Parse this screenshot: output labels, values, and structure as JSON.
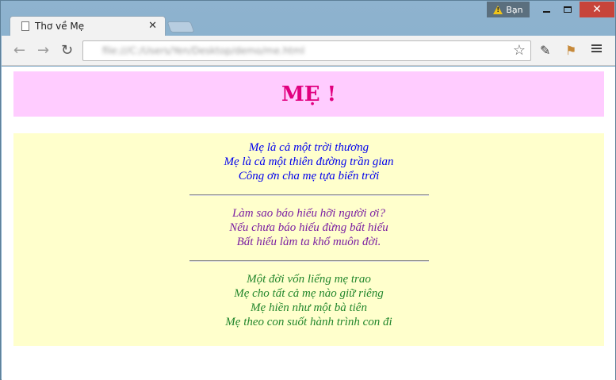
{
  "browser": {
    "tab_title": "Thơ về Mẹ",
    "user_label": "Bạn",
    "url": "file:///C:/Users/Yen/Desktop/demo/me.html"
  },
  "page": {
    "heading": "MẸ !",
    "stanza1": [
      "Mẹ là cả một trời thương",
      "Mẹ là cả một thiên đường trần gian",
      "Công ơn cha mẹ tựa biển trời"
    ],
    "stanza2": [
      "Làm sao báo hiếu hỡi người ơi?",
      "Nếu chưa báo hiếu đừng bất hiếu",
      "Bất hiếu làm ta khổ muôn đời."
    ],
    "stanza3": [
      "Một đời vốn liếng mẹ trao",
      "Mẹ cho tất cả mẹ nào giữ riêng",
      "Mẹ hiền như một bà tiên",
      "Mẹ theo con suốt hành trình con đi"
    ]
  },
  "colors": {
    "banner_bg": "#ffccff",
    "heading": "#e1007f",
    "poem_bg": "#ffffcc",
    "stanza1": "#0000ee",
    "stanza2": "#7b1fa2",
    "stanza3": "#22862c"
  }
}
